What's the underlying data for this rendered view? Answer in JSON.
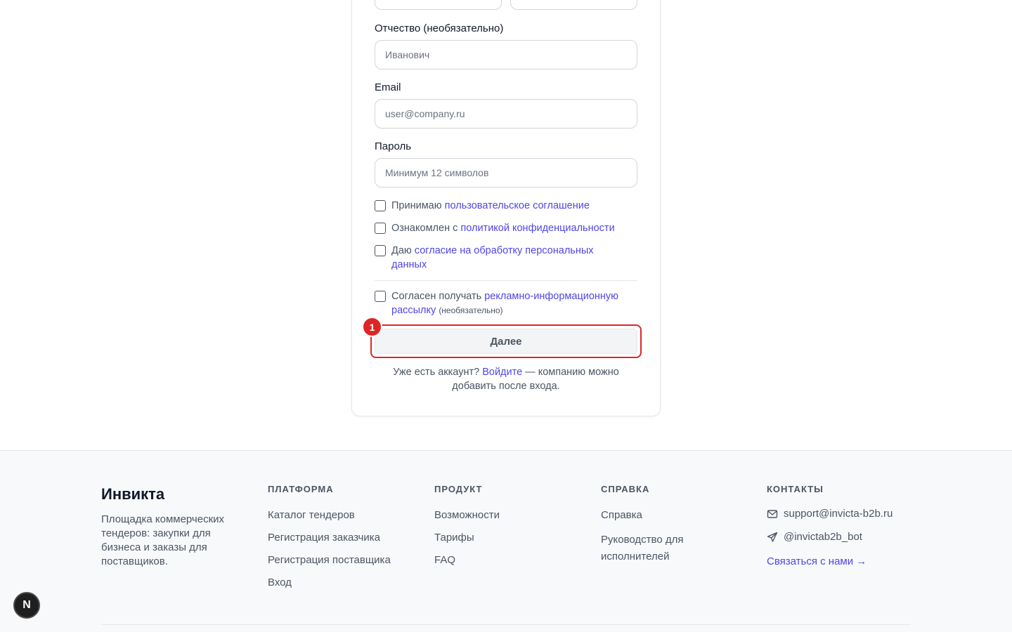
{
  "form": {
    "middle_name": {
      "label": "Отчество (необязательно)",
      "placeholder": "Иванович"
    },
    "email": {
      "label": "Email",
      "placeholder": "user@company.ru"
    },
    "password": {
      "label": "Пароль",
      "placeholder": "Минимум 12 символов"
    },
    "agreements": [
      {
        "prefix": "Принимаю ",
        "link": "пользовательское соглашение"
      },
      {
        "prefix": "Ознакомлен с ",
        "link": "политикой конфиденциальности"
      },
      {
        "prefix": "Даю ",
        "link": "согласие на обработку персональных данных"
      }
    ],
    "newsletter": {
      "prefix": "Согласен получать ",
      "link": "рекламно-информационную рассылку",
      "note": "(необязательно)"
    },
    "submit_label": "Далее",
    "badge": "1",
    "login_note": {
      "prefix": "Уже есть аккаунт? ",
      "link": "Войдите",
      "suffix": " — компанию можно добавить после входа."
    }
  },
  "footer": {
    "brand": "Инвикта",
    "description": "Площадка коммерческих тендеров: закупки для бизнеса и заказы для поставщиков.",
    "platform": {
      "heading": "ПЛАТФОРМА",
      "links": [
        "Каталог тендеров",
        "Регистрация заказчика",
        "Регистрация поставщика",
        "Вход"
      ]
    },
    "product": {
      "heading": "ПРОДУКТ",
      "links": [
        "Возможности",
        "Тарифы",
        "FAQ"
      ]
    },
    "help": {
      "heading": "СПРАВКА",
      "links": [
        "Справка",
        "Руководство для исполнителей"
      ]
    },
    "contacts": {
      "heading": "КОНТАКТЫ",
      "email": "support@invicta-b2b.ru",
      "telegram": "@invictab2b_bot",
      "cta": "Связаться с нами →"
    }
  },
  "dev_indicator": "N",
  "colors": {
    "link": "#4f46e5",
    "highlight": "#dc2626"
  }
}
